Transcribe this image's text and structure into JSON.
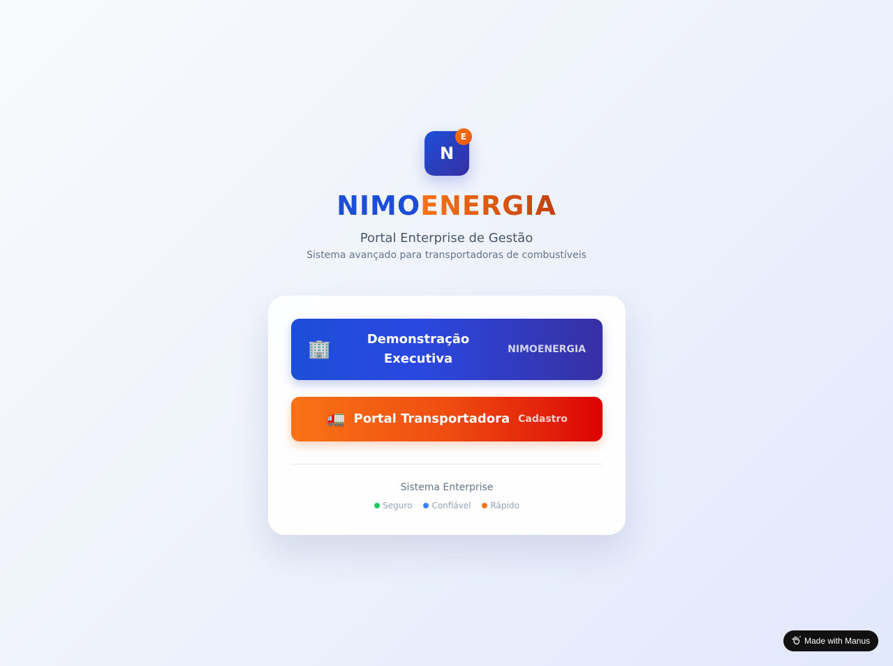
{
  "logo": {
    "letter": "N",
    "badge": "E"
  },
  "brand": {
    "part1": "NIMO",
    "part2": "ENERGIA"
  },
  "header": {
    "subtitle": "Portal Enterprise de Gestão",
    "description": "Sistema avançado para transportadoras de combustíveis"
  },
  "buttons": {
    "demo": {
      "icon": "🏢",
      "label": "Demonstração Executiva",
      "tag": "NIMOENERGIA"
    },
    "portal": {
      "icon": "🚛",
      "label": "Portal Transportadora",
      "tag": "Cadastro"
    }
  },
  "footer": {
    "title": "Sistema Enterprise",
    "features": [
      {
        "label": "Seguro",
        "color": "#22c55e"
      },
      {
        "label": "Confiável",
        "color": "#3b82f6"
      },
      {
        "label": "Rápido",
        "color": "#f97316"
      }
    ]
  },
  "badge": {
    "icon": "manus-hand-icon",
    "label": "Made with Manus"
  },
  "colors": {
    "primary": "#1d4ed8",
    "secondary": "#3730a3",
    "accent": "#f97316",
    "danger": "#dc0000"
  }
}
